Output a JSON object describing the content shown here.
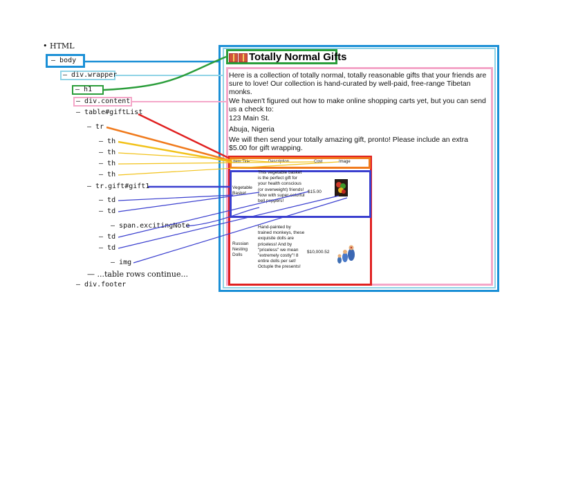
{
  "tree": {
    "root": "HTML",
    "body": "body",
    "wrapper": "div.wrapper",
    "h1": "h1",
    "content": "div.content",
    "table": "table#giftList",
    "tr": "tr",
    "th": "th",
    "tr_gift": "tr.gift#gift1",
    "td": "td",
    "span": "span.excitingNote",
    "img": "img",
    "more": "...table rows continue...",
    "footer": "div.footer"
  },
  "colors": {
    "body": "#1a8fd6",
    "wrapper": "#8fd3e6",
    "h1": "#2a9d3a",
    "content": "#f4a6c8",
    "table": "#e02020",
    "tr": "#f07a1c",
    "th": "#f2c21a",
    "gift": "#3a3fcf"
  },
  "page": {
    "title": "Totally Normal Gifts",
    "intro": "Here is a collection of totally normal, totally reasonable gifts that your friends are sure to love! Our collection is hand-curated by well-paid, free-range Tibetan monks.",
    "shopping": "We haven't figured out how to make online shopping carts yet, but you can send us a check to:",
    "address1": "123 Main St.",
    "address2": "Abuja, Nigeria",
    "closing": "We will then send your totally amazing gift, pronto! Please include an extra $5.00 for gift wrapping.",
    "headers": [
      "Item Title",
      "Description",
      "Cost",
      "Image"
    ],
    "rows": [
      {
        "title": "Vegetable Basket",
        "description": "This vegetable basket is the perfect gift for your health conscious (or overweight) friends! Now with super-colorful bell peppers!",
        "cost": "$15.00"
      },
      {
        "title": "Russian Nesting Dolls",
        "description": "Hand-painted by trained monkeys, these exquisite dolls are priceless! And by \"priceless\" we mean \"extremely costly\"! 8 entire dolls per set! Octuple the presents!",
        "cost": "$10,000.52"
      }
    ]
  }
}
